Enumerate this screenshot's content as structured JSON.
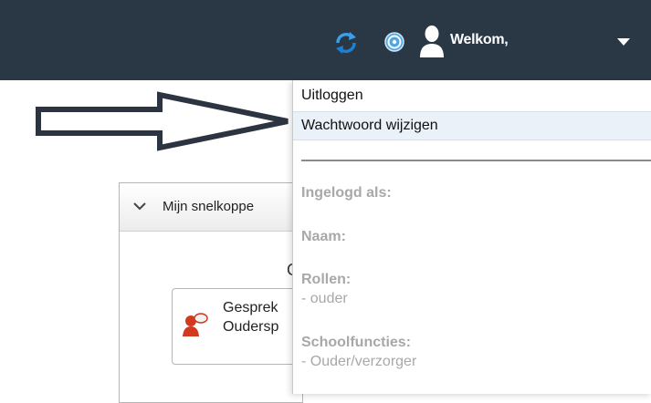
{
  "header": {
    "welcome_text": "Welkom,",
    "icons": [
      "refresh-icon",
      "help-icon",
      "user-icon",
      "caret-down-icon"
    ],
    "bar_color": "#2a3745"
  },
  "user_menu": {
    "items": [
      {
        "label": "Uitloggen"
      },
      {
        "label": "Wachtwoord wijzigen"
      }
    ],
    "info": {
      "logged_in_label": "Ingelogd als:",
      "name_label": "Naam:",
      "roles_label": "Rollen:",
      "roles_value": "- ouder",
      "school_functions_label": "Schoolfuncties:",
      "school_functions_value": "- Ouder/verzorger"
    }
  },
  "shortcuts_panel": {
    "title": "Mijn snelkoppe",
    "heading_letter": "G",
    "tile": {
      "line1": "Gesprek",
      "line2": "Oudersp"
    }
  }
}
